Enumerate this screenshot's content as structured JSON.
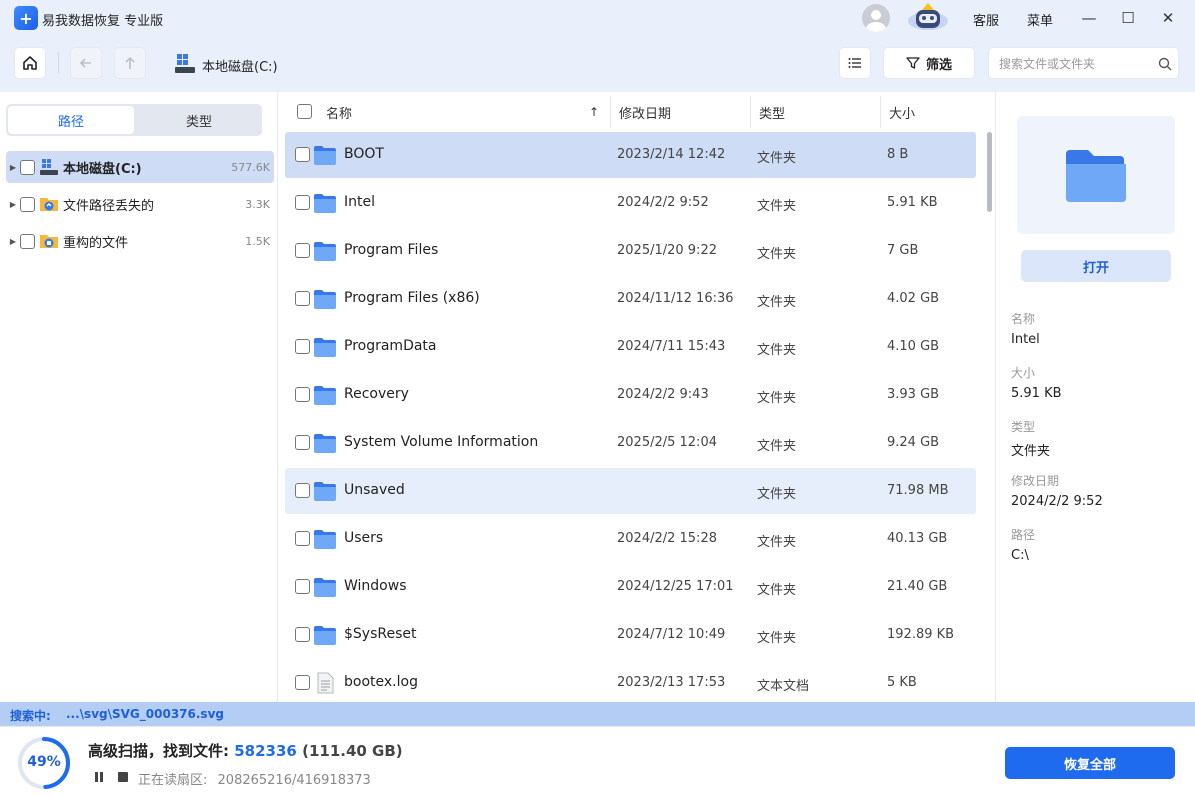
{
  "app": {
    "logo_glyph": "+",
    "title": "易我数据恢复 专业版"
  },
  "titlebar": {
    "service": "客服",
    "menu": "菜单",
    "minimize": "—",
    "maximize": "☐",
    "close": "✕"
  },
  "toolbar": {
    "home_icon": "home-icon",
    "back_icon": "back-arrow-icon",
    "up_icon": "up-arrow-icon",
    "breadcrumb": "本地磁盘(C:)",
    "filter_label": "筛选",
    "search_placeholder": "搜索文件或文件夹"
  },
  "left_panel": {
    "tabs": [
      {
        "label": "路径",
        "active": true
      },
      {
        "label": "类型",
        "active": false
      }
    ],
    "tree": [
      {
        "label": "本地磁盘(C:)",
        "count": "577.6K",
        "icon": "drive-icon",
        "selected": true
      },
      {
        "label": "文件路径丢失的",
        "count": "3.3K",
        "icon": "lost-folder-icon",
        "selected": false
      },
      {
        "label": "重构的文件",
        "count": "1.5K",
        "icon": "rebuilt-folder-icon",
        "selected": false
      }
    ]
  },
  "file_list": {
    "headers": {
      "name": "名称",
      "sort_arrow": "↑",
      "date": "修改日期",
      "type": "类型",
      "size": "大小"
    },
    "rows": [
      {
        "name": "BOOT",
        "date": "2023/2/14 12:42",
        "type": "文件夹",
        "size": "8 B",
        "icon": "folder-icon",
        "state": "selected"
      },
      {
        "name": "Intel",
        "date": "2024/2/2 9:52",
        "type": "文件夹",
        "size": "5.91 KB",
        "icon": "folder-icon",
        "state": ""
      },
      {
        "name": "Program Files",
        "date": "2025/1/20 9:22",
        "type": "文件夹",
        "size": "7 GB",
        "icon": "folder-icon",
        "state": ""
      },
      {
        "name": "Program Files (x86)",
        "date": "2024/11/12 16:36",
        "type": "文件夹",
        "size": "4.02 GB",
        "icon": "folder-icon",
        "state": ""
      },
      {
        "name": "ProgramData",
        "date": "2024/7/11 15:43",
        "type": "文件夹",
        "size": "4.10 GB",
        "icon": "folder-icon",
        "state": ""
      },
      {
        "name": "Recovery",
        "date": "2024/2/2 9:43",
        "type": "文件夹",
        "size": "3.93 GB",
        "icon": "folder-icon",
        "state": ""
      },
      {
        "name": "System Volume Information",
        "date": "2025/2/5 12:04",
        "type": "文件夹",
        "size": "9.24 GB",
        "icon": "folder-icon",
        "state": ""
      },
      {
        "name": "Unsaved",
        "date": "",
        "type": "文件夹",
        "size": "71.98 MB",
        "icon": "folder-icon",
        "state": "hover"
      },
      {
        "name": "Users",
        "date": "2024/2/2 15:28",
        "type": "文件夹",
        "size": "40.13 GB",
        "icon": "folder-icon",
        "state": ""
      },
      {
        "name": "Windows",
        "date": "2024/12/25 17:01",
        "type": "文件夹",
        "size": "21.40 GB",
        "icon": "folder-icon",
        "state": ""
      },
      {
        "name": "$SysReset",
        "date": "2024/7/12 10:49",
        "type": "文件夹",
        "size": "192.89 KB",
        "icon": "folder-icon",
        "state": ""
      },
      {
        "name": "bootex.log",
        "date": "2023/2/13 17:53",
        "type": "文本文档",
        "size": "5 KB",
        "icon": "text-file-icon",
        "state": ""
      }
    ]
  },
  "details": {
    "open_button": "打开",
    "fields": [
      {
        "label": "名称",
        "value": "Intel"
      },
      {
        "label": "大小",
        "value": "5.91 KB"
      },
      {
        "label": "类型",
        "value": "文件夹"
      },
      {
        "label": "修改日期",
        "value": "2024/2/2 9:52"
      },
      {
        "label": "路径",
        "value": "C:\\"
      }
    ]
  },
  "search_status": {
    "label": "搜索中:",
    "path": "...\\svg\\SVG_000376.svg"
  },
  "scan": {
    "progress_percent": 49,
    "progress_label": "49%",
    "title_prefix": "高级扫描，找到文件:",
    "found_count": "582336",
    "found_size": "(111.40 GB)",
    "sector_label": "正在读扇区:",
    "sector_value": "208265216/416918373",
    "recover_all": "恢复全部"
  },
  "colors": {
    "accent": "#1f6bf0",
    "selected_row": "#cfdcf6",
    "folder": "#5b9cf5",
    "bar": "#b3cdf4"
  }
}
